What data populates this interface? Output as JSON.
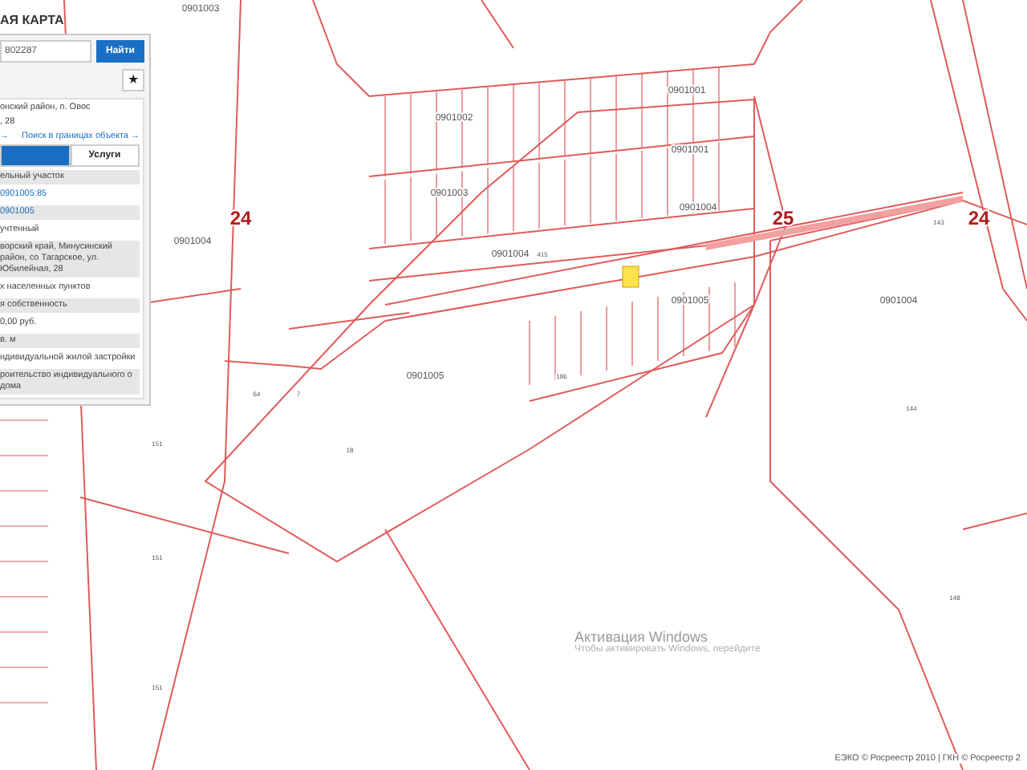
{
  "panel": {
    "title": "АЯ КАРТА",
    "search": {
      "value": "802287"
    },
    "search_button": "Найти",
    "favorite_button": "★",
    "card": {
      "address": [
        "онский район, п. Овос",
        ", 28"
      ],
      "arrow_link": "→",
      "boundary_link": "Поиск в границах объекта →",
      "tabs": [
        {
          "selected": true
        },
        {
          "label": "Услуги",
          "selected": false
        }
      ],
      "rows": [
        {
          "text": "ельный участок",
          "kind": "plain"
        },
        {
          "text": "0901005:85",
          "kind": "link"
        },
        {
          "text": "0901005",
          "kind": "link"
        },
        {
          "text": "учтенный",
          "kind": "plain"
        },
        {
          "text": "ворский край, Минусинский район, со Тагарское, ул. Юбилейная, 28",
          "kind": "plain"
        },
        {
          "text": "х населенных пунктов",
          "kind": "plain"
        },
        {
          "text": "я собственность",
          "kind": "plain"
        },
        {
          "text": "0,00 руб.",
          "kind": "plain"
        },
        {
          "text": "в. м",
          "kind": "plain"
        },
        {
          "text": "ндивидуальной жилой застройки",
          "kind": "plain"
        },
        {
          "text": "роительство индивидуального о дома",
          "kind": "plain"
        }
      ]
    }
  },
  "map": {
    "labels": [
      {
        "text": "0901003",
        "kind": "block"
      },
      {
        "text": "0901001",
        "kind": "block"
      },
      {
        "text": "0901002",
        "kind": "block"
      },
      {
        "text": "0901001",
        "kind": "block"
      },
      {
        "text": "0901003",
        "kind": "block"
      },
      {
        "text": "0901004",
        "kind": "block"
      },
      {
        "text": "24",
        "kind": "region"
      },
      {
        "text": "25",
        "kind": "region"
      },
      {
        "text": "143",
        "kind": "parcel"
      },
      {
        "text": "24",
        "kind": "region"
      },
      {
        "text": "0901004",
        "kind": "block"
      },
      {
        "text": "0901004",
        "kind": "block"
      },
      {
        "text": "415",
        "kind": "parcel"
      },
      {
        "text": "0901005",
        "kind": "block"
      },
      {
        "text": "0901004",
        "kind": "block"
      },
      {
        "text": "0901005",
        "kind": "block"
      },
      {
        "text": "186",
        "kind": "parcel"
      },
      {
        "text": "64",
        "kind": "parcel"
      },
      {
        "text": "7",
        "kind": "parcel"
      },
      {
        "text": "144",
        "kind": "parcel"
      },
      {
        "text": "151",
        "kind": "parcel"
      },
      {
        "text": "18",
        "kind": "parcel"
      },
      {
        "text": "151",
        "kind": "parcel"
      },
      {
        "text": "148",
        "kind": "parcel"
      },
      {
        "text": "151",
        "kind": "parcel"
      }
    ]
  },
  "activation_notice": {
    "title": "Активация Windows",
    "subtitle": "Чтобы активировать Windows, перейдите"
  },
  "attribution": "ЕЭКО © Росреестр 2010 | ГКН © Росреестр 2"
}
